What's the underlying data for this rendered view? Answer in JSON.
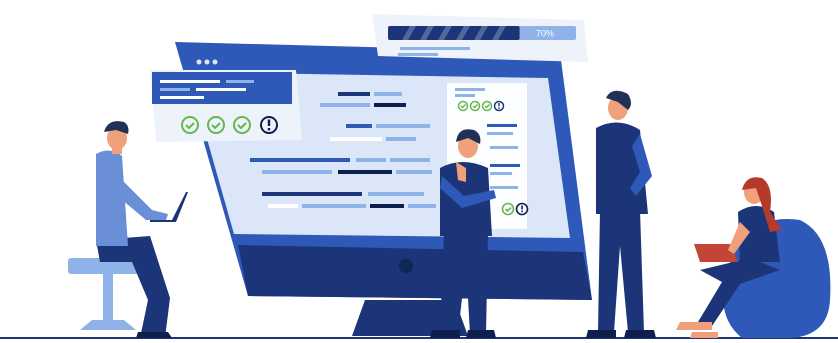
{
  "progress_card": {
    "label": "70%",
    "progress": 0.7
  },
  "colors": {
    "navy": "#1c3579",
    "blue": "#2e59b8",
    "light_blue": "#8fb3e8",
    "screen_bg": "#dbe7f8",
    "check_green": "#64b84f",
    "skin": "#f0a07a",
    "hair": "#213056",
    "hair_red": "#b53a2c"
  },
  "icons": {
    "left_card": [
      "check-icon",
      "check-icon",
      "check-icon",
      "exclamation-icon"
    ],
    "screen_panel_top": [
      "check-icon",
      "check-icon",
      "check-icon"
    ],
    "screen_panel_bottom": [
      "check-icon",
      "exclamation-icon"
    ]
  }
}
